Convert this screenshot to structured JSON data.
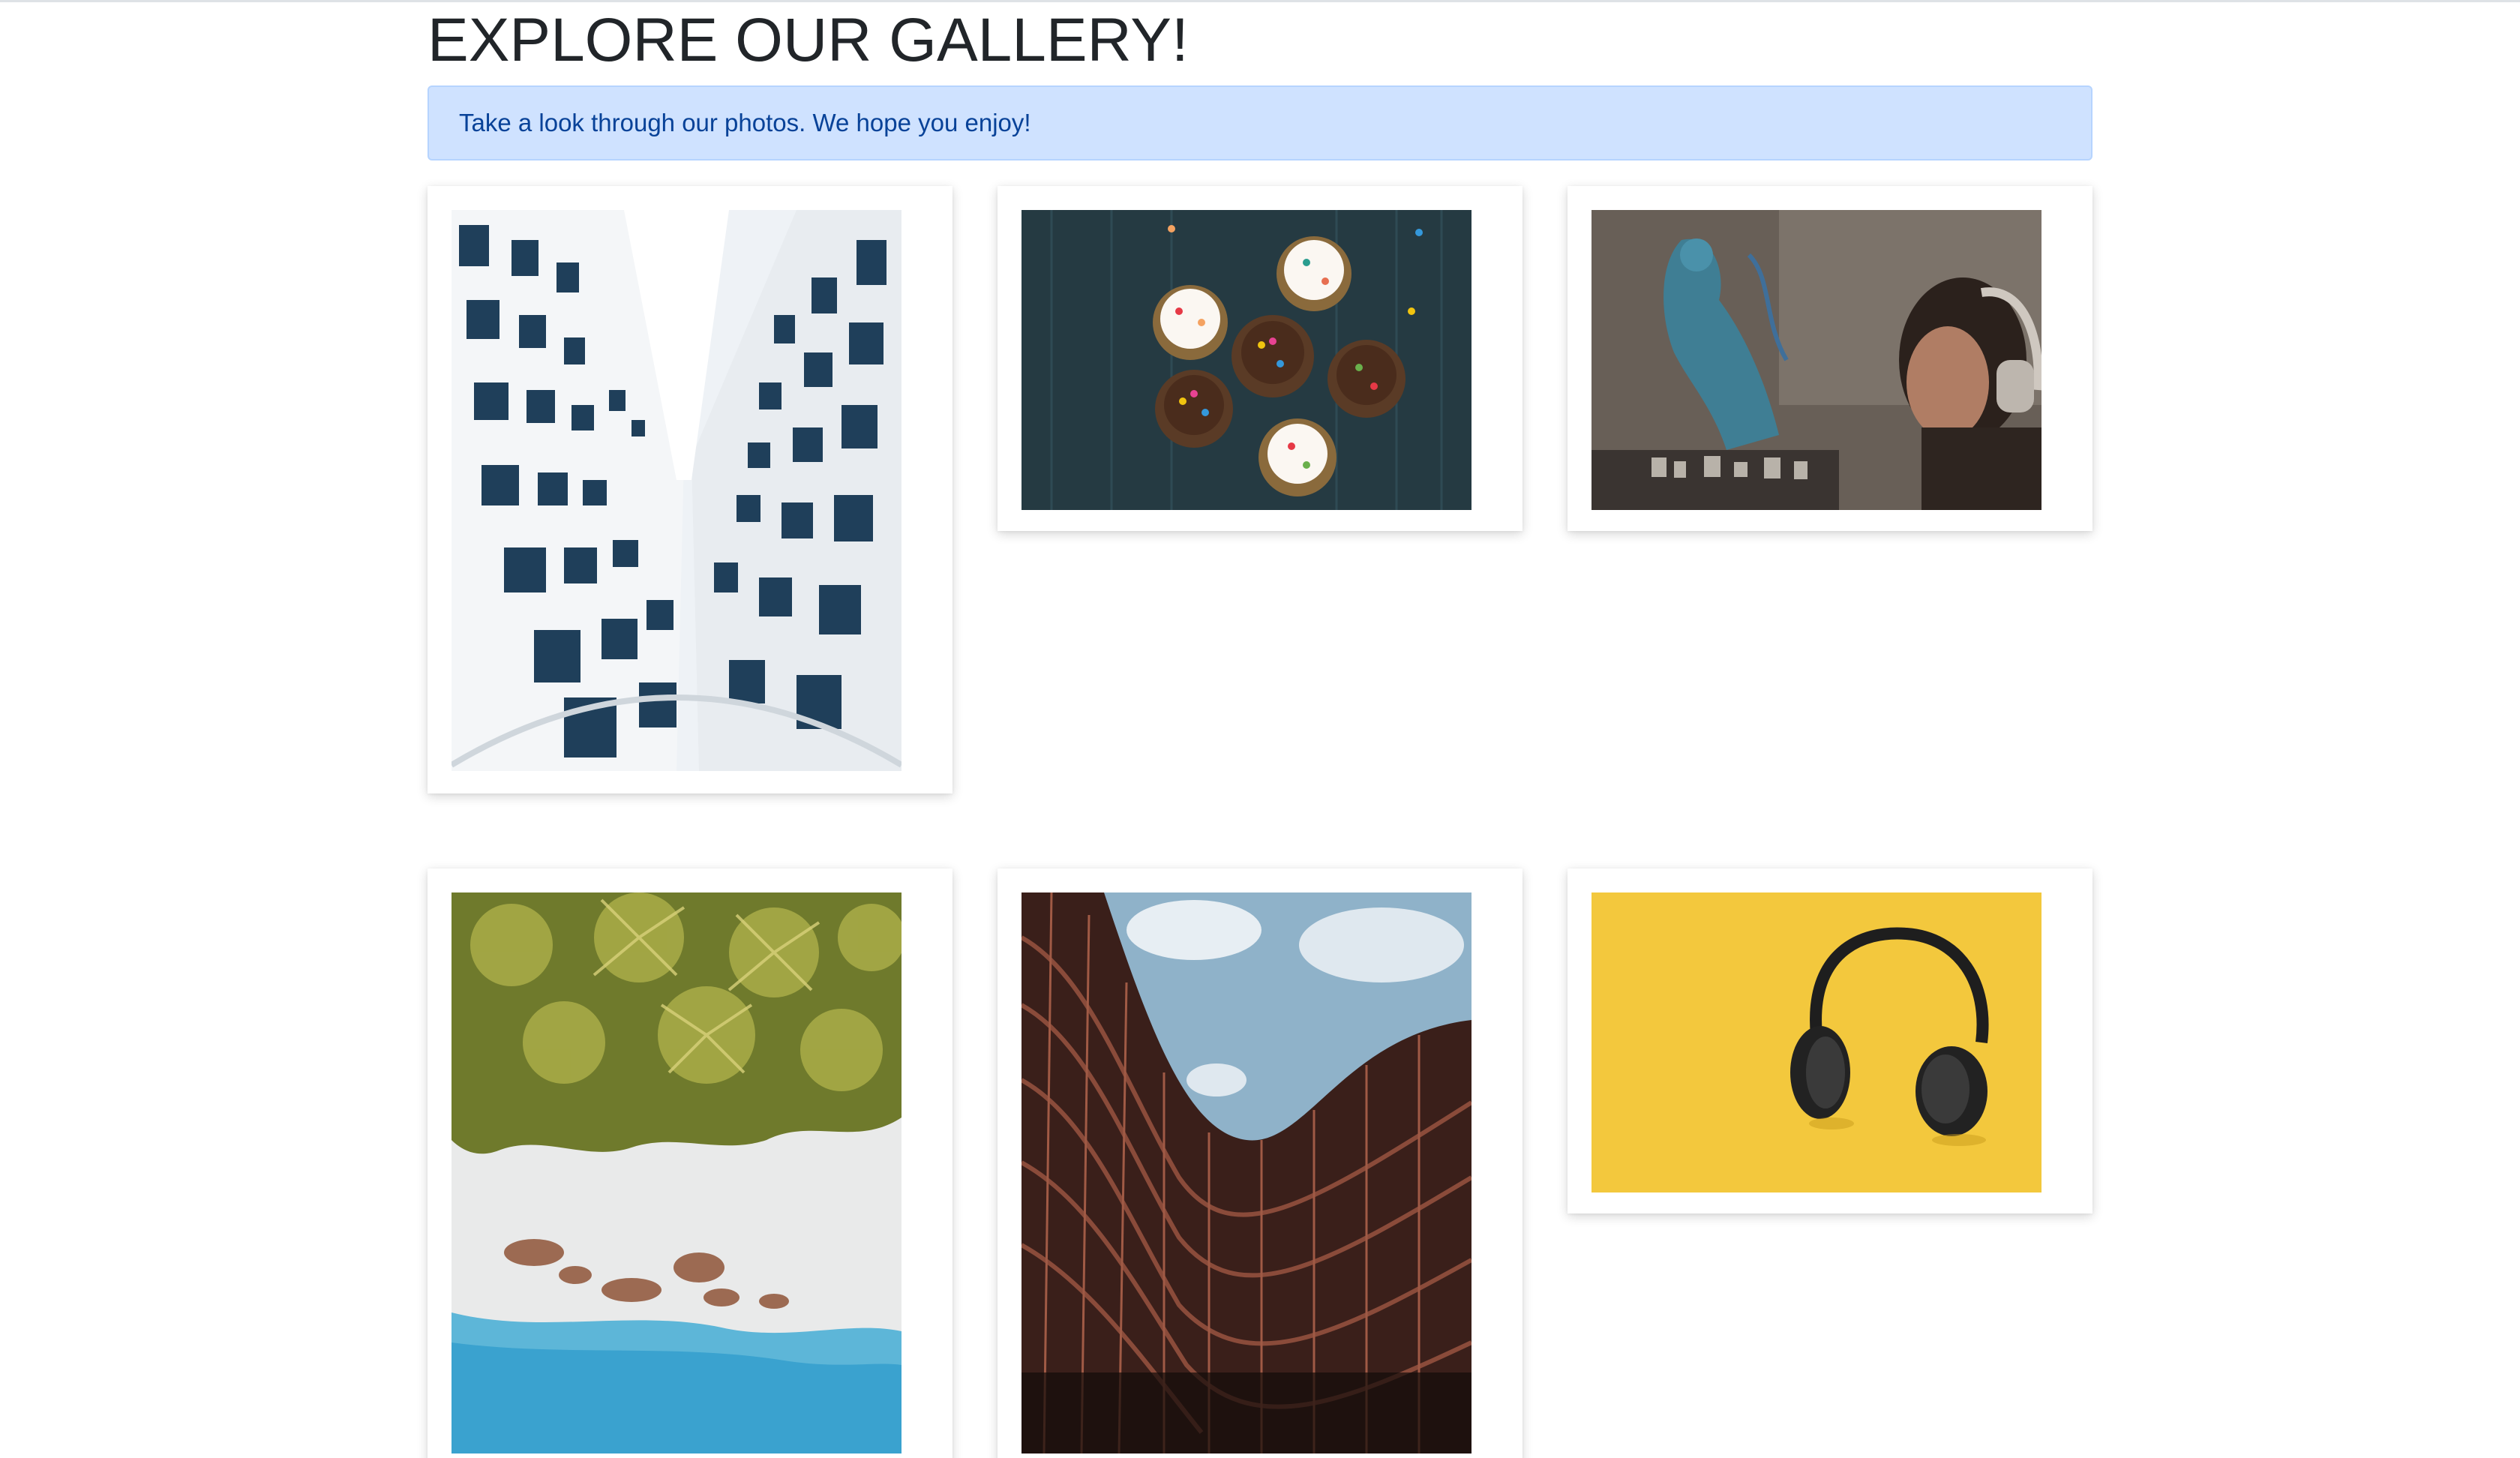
{
  "header": {
    "title": "EXPLORE OUR GALLERY!"
  },
  "alert": {
    "message": "Take a look through our photos. We hope you enjoy!"
  },
  "gallery": {
    "photos": [
      {
        "subject": "building-looking-up"
      },
      {
        "subject": "cupcakes"
      },
      {
        "subject": "graffiti-wall-headphones-person"
      },
      {
        "subject": "aerial-beach-palms"
      },
      {
        "subject": "wavy-building-facade"
      },
      {
        "subject": "headphones-yellow-background"
      }
    ]
  },
  "colors": {
    "alert_bg": "#cfe2ff",
    "alert_text": "#084298",
    "title_text": "#212529",
    "yellow_bg": "#f2c22e"
  }
}
